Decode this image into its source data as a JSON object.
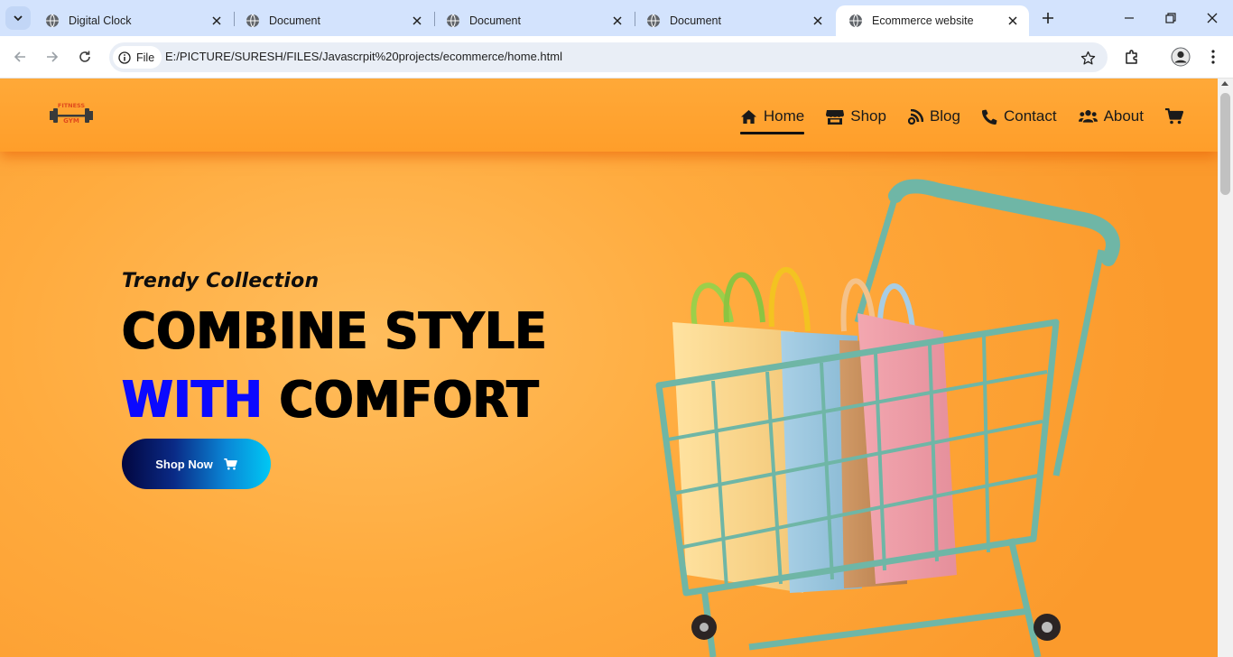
{
  "browser": {
    "tabs": [
      {
        "title": "Digital Clock",
        "active": false
      },
      {
        "title": "Document",
        "active": false
      },
      {
        "title": "Document",
        "active": false
      },
      {
        "title": "Document",
        "active": false
      },
      {
        "title": "Ecommerce website",
        "active": true
      }
    ],
    "security_chip": "File",
    "url": "E:/PICTURE/SURESH/FILES/Javascrpit%20projects/ecommerce/home.html"
  },
  "site": {
    "logo": {
      "line1": "FITNESS",
      "line2": "GYM"
    },
    "nav": [
      {
        "label": "Home",
        "icon": "home-icon",
        "active": true
      },
      {
        "label": "Shop",
        "icon": "store-icon",
        "active": false
      },
      {
        "label": "Blog",
        "icon": "blog-rss-icon",
        "active": false
      },
      {
        "label": "Contact",
        "icon": "phone-icon",
        "active": false
      },
      {
        "label": "About",
        "icon": "users-icon",
        "active": false
      }
    ],
    "cart_icon": "shopping-cart-icon"
  },
  "hero": {
    "kicker": "Trendy Collection",
    "headline_line1": "COMBINE STYLE",
    "headline_accent": "WITH",
    "headline_rest": "COMFORT",
    "cta_label": "Shop Now",
    "cta_icon": "shopping-cart-icon",
    "image": "shopping-cart-with-paper-bags"
  },
  "colors": {
    "hero_background": "#ffab3e",
    "accent_text": "#0b09ff",
    "cta_gradient_start": "#02063f",
    "cta_gradient_end": "#00c8f4"
  }
}
